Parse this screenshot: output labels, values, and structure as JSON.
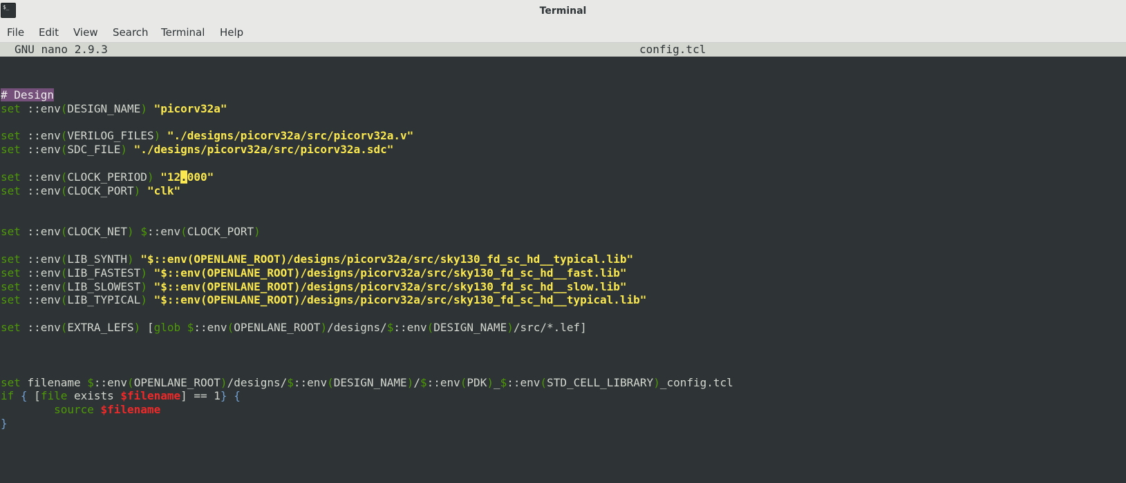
{
  "window": {
    "title": "Terminal",
    "icon_text": "$_"
  },
  "menubar": {
    "items": [
      "File",
      "Edit",
      "View",
      "Search",
      "Terminal",
      "Help"
    ]
  },
  "nano": {
    "version": "GNU nano 2.9.3",
    "filename": "config.tcl"
  },
  "colors": {
    "background": "#2e3436",
    "keyword": "#4e9a06",
    "string": "#fce94f",
    "variable": "#ef2929",
    "brace": "#729fcf",
    "comment_bg": "#75507b",
    "header_bg": "#d3d7cf"
  },
  "code": {
    "lines": [
      {
        "row": 2,
        "tokens": [
          {
            "t": "# Design",
            "c": "comment"
          }
        ]
      },
      {
        "row": 3,
        "tokens": [
          {
            "t": "set",
            "c": "kw"
          },
          {
            "t": " ::env",
            "c": "plain"
          },
          {
            "t": "(",
            "c": "kw"
          },
          {
            "t": "DESIGN_NAME",
            "c": "plain"
          },
          {
            "t": ") ",
            "c": "kw"
          },
          {
            "t": "\"picorv32a\"",
            "c": "str"
          }
        ]
      },
      {
        "row": 5,
        "tokens": [
          {
            "t": "set",
            "c": "kw"
          },
          {
            "t": " ::env",
            "c": "plain"
          },
          {
            "t": "(",
            "c": "kw"
          },
          {
            "t": "VERILOG_FILES",
            "c": "plain"
          },
          {
            "t": ") ",
            "c": "kw"
          },
          {
            "t": "\"./designs/picorv32a/src/picorv32a.v\"",
            "c": "str"
          }
        ]
      },
      {
        "row": 6,
        "tokens": [
          {
            "t": "set",
            "c": "kw"
          },
          {
            "t": " ::env",
            "c": "plain"
          },
          {
            "t": "(",
            "c": "kw"
          },
          {
            "t": "SDC_FILE",
            "c": "plain"
          },
          {
            "t": ") ",
            "c": "kw"
          },
          {
            "t": "\"./designs/picorv32a/src/picorv32a.sdc\"",
            "c": "str"
          }
        ]
      },
      {
        "row": 8,
        "tokens": [
          {
            "t": "set",
            "c": "kw"
          },
          {
            "t": " ::env",
            "c": "plain"
          },
          {
            "t": "(",
            "c": "kw"
          },
          {
            "t": "CLOCK_PERIOD",
            "c": "plain"
          },
          {
            "t": ") ",
            "c": "kw"
          },
          {
            "t": "\"12",
            "c": "str"
          },
          {
            "t": ".",
            "c": "cursor"
          },
          {
            "t": "000\"",
            "c": "str"
          }
        ]
      },
      {
        "row": 9,
        "tokens": [
          {
            "t": "set",
            "c": "kw"
          },
          {
            "t": " ::env",
            "c": "plain"
          },
          {
            "t": "(",
            "c": "kw"
          },
          {
            "t": "CLOCK_PORT",
            "c": "plain"
          },
          {
            "t": ") ",
            "c": "kw"
          },
          {
            "t": "\"clk\"",
            "c": "str"
          }
        ]
      },
      {
        "row": 12,
        "tokens": [
          {
            "t": "set",
            "c": "kw"
          },
          {
            "t": " ::env",
            "c": "plain"
          },
          {
            "t": "(",
            "c": "kw"
          },
          {
            "t": "CLOCK_NET",
            "c": "plain"
          },
          {
            "t": ") ",
            "c": "kw"
          },
          {
            "t": "$",
            "c": "kw"
          },
          {
            "t": "::env",
            "c": "plain"
          },
          {
            "t": "(",
            "c": "kw"
          },
          {
            "t": "CLOCK_PORT",
            "c": "plain"
          },
          {
            "t": ")",
            "c": "kw"
          }
        ]
      },
      {
        "row": 14,
        "tokens": [
          {
            "t": "set",
            "c": "kw"
          },
          {
            "t": " ::env",
            "c": "plain"
          },
          {
            "t": "(",
            "c": "kw"
          },
          {
            "t": "LIB_SYNTH",
            "c": "plain"
          },
          {
            "t": ") ",
            "c": "kw"
          },
          {
            "t": "\"$::env(OPENLANE_ROOT)/designs/picorv32a/src/sky130_fd_sc_hd__typical.lib\"",
            "c": "str"
          }
        ]
      },
      {
        "row": 15,
        "tokens": [
          {
            "t": "set",
            "c": "kw"
          },
          {
            "t": " ::env",
            "c": "plain"
          },
          {
            "t": "(",
            "c": "kw"
          },
          {
            "t": "LIB_FASTEST",
            "c": "plain"
          },
          {
            "t": ") ",
            "c": "kw"
          },
          {
            "t": "\"$::env(OPENLANE_ROOT)/designs/picorv32a/src/sky130_fd_sc_hd__fast.lib\"",
            "c": "str"
          }
        ]
      },
      {
        "row": 16,
        "tokens": [
          {
            "t": "set",
            "c": "kw"
          },
          {
            "t": " ::env",
            "c": "plain"
          },
          {
            "t": "(",
            "c": "kw"
          },
          {
            "t": "LIB_SLOWEST",
            "c": "plain"
          },
          {
            "t": ") ",
            "c": "kw"
          },
          {
            "t": "\"$::env(OPENLANE_ROOT)/designs/picorv32a/src/sky130_fd_sc_hd__slow.lib\"",
            "c": "str"
          }
        ]
      },
      {
        "row": 17,
        "tokens": [
          {
            "t": "set",
            "c": "kw"
          },
          {
            "t": " ::env",
            "c": "plain"
          },
          {
            "t": "(",
            "c": "kw"
          },
          {
            "t": "LIB_TYPICAL",
            "c": "plain"
          },
          {
            "t": ") ",
            "c": "kw"
          },
          {
            "t": "\"$::env(OPENLANE_ROOT)/designs/picorv32a/src/sky130_fd_sc_hd__typical.lib\"",
            "c": "str"
          }
        ]
      },
      {
        "row": 19,
        "tokens": [
          {
            "t": "set",
            "c": "kw"
          },
          {
            "t": " ::env",
            "c": "plain"
          },
          {
            "t": "(",
            "c": "kw"
          },
          {
            "t": "EXTRA_LEFS",
            "c": "plain"
          },
          {
            "t": ") ",
            "c": "kw"
          },
          {
            "t": "[",
            "c": "plain"
          },
          {
            "t": "glob",
            "c": "kw"
          },
          {
            "t": " ",
            "c": "plain"
          },
          {
            "t": "$",
            "c": "kw"
          },
          {
            "t": "::env",
            "c": "plain"
          },
          {
            "t": "(",
            "c": "kw"
          },
          {
            "t": "OPENLANE_ROOT",
            "c": "plain"
          },
          {
            "t": ")",
            "c": "kw"
          },
          {
            "t": "/designs/",
            "c": "plain"
          },
          {
            "t": "$",
            "c": "kw"
          },
          {
            "t": "::env",
            "c": "plain"
          },
          {
            "t": "(",
            "c": "kw"
          },
          {
            "t": "DESIGN_NAME",
            "c": "plain"
          },
          {
            "t": ")",
            "c": "kw"
          },
          {
            "t": "/src/*.lef]",
            "c": "plain"
          }
        ]
      },
      {
        "row": 23,
        "tokens": [
          {
            "t": "set",
            "c": "kw"
          },
          {
            "t": " filename ",
            "c": "plain"
          },
          {
            "t": "$",
            "c": "kw"
          },
          {
            "t": "::env",
            "c": "plain"
          },
          {
            "t": "(",
            "c": "kw"
          },
          {
            "t": "OPENLANE_ROOT",
            "c": "plain"
          },
          {
            "t": ")",
            "c": "kw"
          },
          {
            "t": "/designs/",
            "c": "plain"
          },
          {
            "t": "$",
            "c": "kw"
          },
          {
            "t": "::env",
            "c": "plain"
          },
          {
            "t": "(",
            "c": "kw"
          },
          {
            "t": "DESIGN_NAME",
            "c": "plain"
          },
          {
            "t": ")",
            "c": "kw"
          },
          {
            "t": "/",
            "c": "plain"
          },
          {
            "t": "$",
            "c": "kw"
          },
          {
            "t": "::env",
            "c": "plain"
          },
          {
            "t": "(",
            "c": "kw"
          },
          {
            "t": "PDK",
            "c": "plain"
          },
          {
            "t": ")",
            "c": "kw"
          },
          {
            "t": "_",
            "c": "plain"
          },
          {
            "t": "$",
            "c": "kw"
          },
          {
            "t": "::env",
            "c": "plain"
          },
          {
            "t": "(",
            "c": "kw"
          },
          {
            "t": "STD_CELL_LIBRARY",
            "c": "plain"
          },
          {
            "t": ")",
            "c": "kw"
          },
          {
            "t": "_config.tcl",
            "c": "plain"
          }
        ]
      },
      {
        "row": 24,
        "tokens": [
          {
            "t": "if",
            "c": "kw"
          },
          {
            "t": " ",
            "c": "plain"
          },
          {
            "t": "{",
            "c": "brace"
          },
          {
            "t": " [",
            "c": "plain"
          },
          {
            "t": "file",
            "c": "kw"
          },
          {
            "t": " exists ",
            "c": "plain"
          },
          {
            "t": "$filename",
            "c": "var"
          },
          {
            "t": "] == 1",
            "c": "plain"
          },
          {
            "t": "}",
            "c": "brace"
          },
          {
            "t": " ",
            "c": "plain"
          },
          {
            "t": "{",
            "c": "brace"
          }
        ]
      },
      {
        "row": 25,
        "tokens": [
          {
            "t": "        ",
            "c": "plain"
          },
          {
            "t": "source",
            "c": "kw"
          },
          {
            "t": " ",
            "c": "plain"
          },
          {
            "t": "$filename",
            "c": "var"
          }
        ]
      },
      {
        "row": 26,
        "tokens": [
          {
            "t": "}",
            "c": "brace"
          }
        ]
      }
    ]
  }
}
